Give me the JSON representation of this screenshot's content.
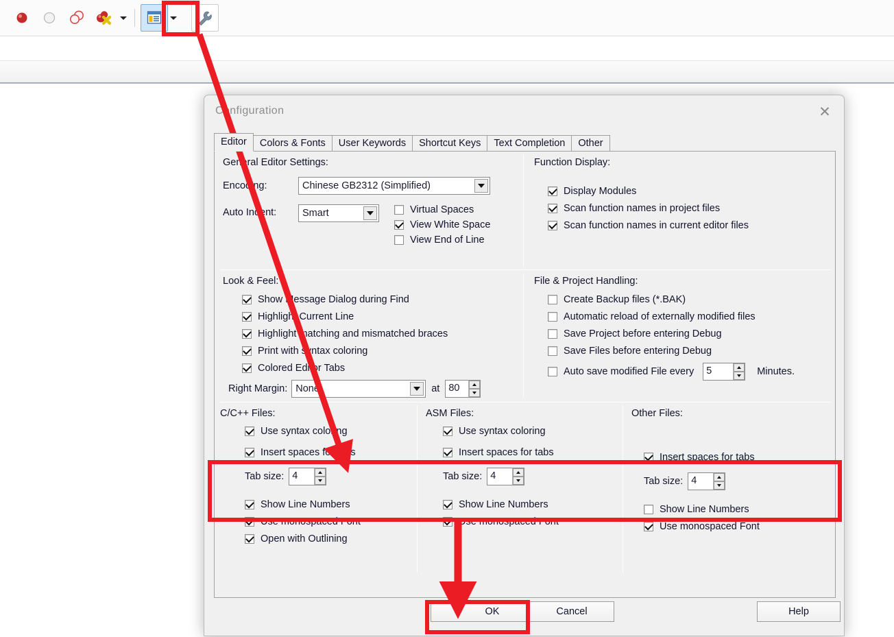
{
  "toolbar": {
    "icons": [
      {
        "name": "breakpoint-icon",
        "label": "Toggle Breakpoint"
      },
      {
        "name": "breakpoint-disabled-icon",
        "label": "Disable Breakpoint"
      },
      {
        "name": "breakpoints-copy-icon",
        "label": "Breakpoints"
      },
      {
        "name": "breakpoint-delete-icon",
        "label": "Remove All Breakpoints"
      }
    ],
    "dropdown_caret": "▼",
    "workspace_icon": "workspace-panel-icon",
    "config_icon": "wrench-icon"
  },
  "dialog": {
    "title": "Configuration",
    "close_label": "✕",
    "tabs": [
      {
        "label": "Editor",
        "selected": true
      },
      {
        "label": "Colors & Fonts",
        "selected": false
      },
      {
        "label": "User Keywords",
        "selected": false
      },
      {
        "label": "Shortcut Keys",
        "selected": false
      },
      {
        "label": "Text Completion",
        "selected": false
      },
      {
        "label": "Other",
        "selected": false
      }
    ],
    "general": {
      "title": "General Editor Settings:",
      "encoding_label": "Encoding:",
      "encoding_value": "Chinese GB2312 (Simplified)",
      "auto_indent_label": "Auto Indent:",
      "auto_indent_value": "Smart",
      "options": [
        {
          "label": "Virtual Spaces",
          "checked": false
        },
        {
          "label": "View White Space",
          "checked": true
        },
        {
          "label": "View End of Line",
          "checked": false
        }
      ]
    },
    "function_display": {
      "title": "Function Display:",
      "options": [
        {
          "label": "Display Modules",
          "checked": true
        },
        {
          "label": "Scan function names in project files",
          "checked": true
        },
        {
          "label": "Scan function names in current editor files",
          "checked": true
        }
      ]
    },
    "look_feel": {
      "title": "Look & Feel:",
      "options": [
        {
          "label": "Show Message Dialog during Find",
          "checked": true
        },
        {
          "label": "Highlight Current Line",
          "checked": true
        },
        {
          "label": "Highlight matching and mismatched braces",
          "checked": true
        },
        {
          "label": "Print with syntax coloring",
          "checked": true
        },
        {
          "label": "Colored Editor Tabs",
          "checked": true
        }
      ],
      "right_margin_label": "Right Margin:",
      "right_margin_value": "None",
      "at_label": "at",
      "at_value": "80"
    },
    "file_project": {
      "title": "File & Project Handling:",
      "options": [
        {
          "label": "Create Backup files (*.BAK)",
          "checked": false
        },
        {
          "label": "Automatic reload of externally modified files",
          "checked": false
        },
        {
          "label": "Save Project before entering Debug",
          "checked": false
        },
        {
          "label": "Save Files before entering Debug",
          "checked": false
        }
      ],
      "autosave_label": "Auto save modified File every",
      "autosave_checked": false,
      "autosave_value": "5",
      "autosave_suffix": "Minutes."
    },
    "file_types": [
      {
        "title": "C/C++ Files:",
        "syntax": {
          "label": "Use syntax coloring",
          "checked": true,
          "present": true
        },
        "insert_spaces": {
          "label": "Insert spaces for tabs",
          "checked": true
        },
        "tab_size_label": "Tab size:",
        "tab_size_value": "4",
        "after": [
          {
            "label": "Show Line Numbers",
            "checked": true
          },
          {
            "label": "Use monospaced Font",
            "checked": true
          },
          {
            "label": "Open with Outlining",
            "checked": true
          }
        ]
      },
      {
        "title": "ASM Files:",
        "syntax": {
          "label": "Use syntax coloring",
          "checked": true,
          "present": true
        },
        "insert_spaces": {
          "label": "Insert spaces for tabs",
          "checked": true
        },
        "tab_size_label": "Tab size:",
        "tab_size_value": "4",
        "after": [
          {
            "label": "Show Line Numbers",
            "checked": true
          },
          {
            "label": "Use monospaced Font",
            "checked": true
          }
        ]
      },
      {
        "title": "Other Files:",
        "syntax": {
          "label": "",
          "checked": false,
          "present": false
        },
        "insert_spaces": {
          "label": "Insert spaces for tabs",
          "checked": true
        },
        "tab_size_label": "Tab size:",
        "tab_size_value": "4",
        "after": [
          {
            "label": "Show Line Numbers",
            "checked": false
          },
          {
            "label": "Use monospaced Font",
            "checked": true
          }
        ]
      }
    ],
    "buttons": {
      "ok": "OK",
      "cancel": "Cancel",
      "help": "Help"
    }
  },
  "annotations": {
    "highlight_color": "#ec1c24",
    "boxes": [
      "wrench-toolbar-button",
      "insert-spaces-row",
      "ok-button"
    ],
    "arrows": [
      "wrench-to-insert-spaces",
      "insert-spaces-to-ok"
    ]
  }
}
